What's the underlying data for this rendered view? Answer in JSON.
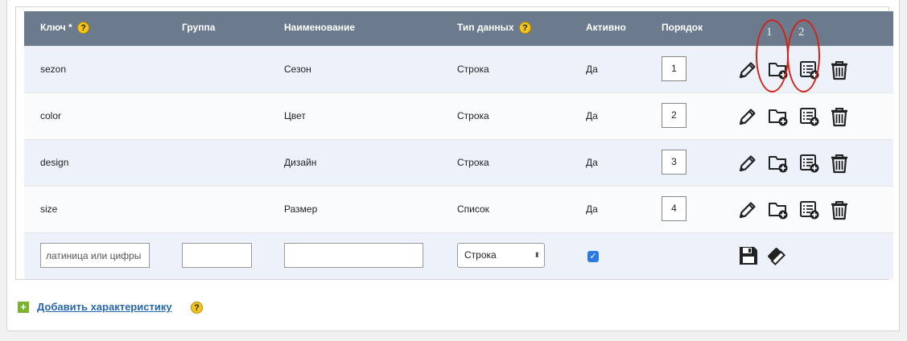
{
  "table": {
    "headers": {
      "key": "Ключ *",
      "group": "Группа",
      "name": "Наименование",
      "type": "Тип данных",
      "active": "Активно",
      "order": "Порядок"
    },
    "help_glyph": "?",
    "rows": [
      {
        "key": "sezon",
        "group": "",
        "name": "Сезон",
        "type": "Строка",
        "active": "Да",
        "order": "1"
      },
      {
        "key": "color",
        "group": "",
        "name": "Цвет",
        "type": "Строка",
        "active": "Да",
        "order": "2"
      },
      {
        "key": "design",
        "group": "",
        "name": "Дизайн",
        "type": "Строка",
        "active": "Да",
        "order": "3"
      },
      {
        "key": "size",
        "group": "",
        "name": "Размер",
        "type": "Список",
        "active": "Да",
        "order": "4"
      }
    ],
    "row_icons": [
      "pencil-icon",
      "folder-plus-icon",
      "list-plus-icon",
      "trash-icon"
    ],
    "new_row": {
      "key_placeholder": "латиница или цифры",
      "group_value": "",
      "name_value": "",
      "type_selected": "Строка",
      "active_checked": true,
      "icons": [
        "floppy-disk-icon",
        "eraser-icon"
      ]
    }
  },
  "annotations": {
    "label_1": "1",
    "label_2": "2",
    "color": "#d0241b"
  },
  "footer": {
    "add_label": "Добавить характеристику",
    "plus_glyph": "+",
    "help_glyph": "?"
  },
  "colors": {
    "header_bg": "#6b7a8c",
    "row_alt_bg": "#edf2fa",
    "link": "#2766b0",
    "plus": "#7bb32e",
    "checkbox": "#2a7ae2"
  }
}
